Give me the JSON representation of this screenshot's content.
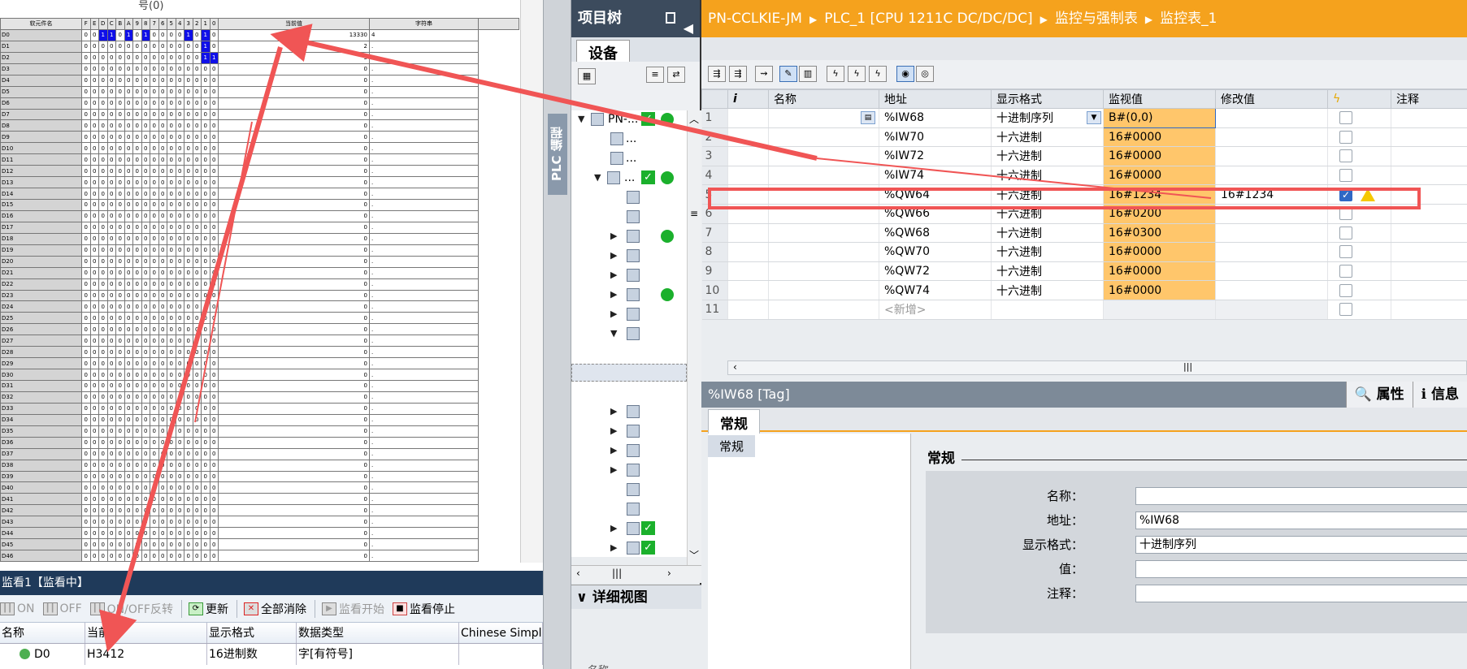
{
  "gx": {
    "title_fragment": "号(0)",
    "headers": {
      "device": "软元件名",
      "bits": [
        "F",
        "E",
        "D",
        "C",
        "B",
        "A",
        "9",
        "8",
        "7",
        "6",
        "5",
        "4",
        "3",
        "2",
        "1",
        "0"
      ],
      "value": "当前值",
      "string": "字符串"
    },
    "rows": [
      {
        "dev": "D0",
        "bits": "0011010100001010",
        "val": "13330",
        "str": "4"
      },
      {
        "dev": "D1",
        "bits": "0000000000000010",
        "val": "2",
        "str": "."
      },
      {
        "dev": "D2",
        "bits": "0000000000000011",
        "val": "3",
        "str": "."
      },
      {
        "dev": "D3",
        "bits": "0000000000000000",
        "val": "0",
        "str": "."
      },
      {
        "dev": "D4",
        "bits": "0000000000000000",
        "val": "0",
        "str": "."
      },
      {
        "dev": "D5",
        "bits": "0000000000000000",
        "val": "0",
        "str": "."
      },
      {
        "dev": "D6",
        "bits": "0000000000000000",
        "val": "0",
        "str": "."
      },
      {
        "dev": "D7",
        "bits": "0000000000000000",
        "val": "0",
        "str": "."
      },
      {
        "dev": "D8",
        "bits": "0000000000000000",
        "val": "0",
        "str": "."
      },
      {
        "dev": "D9",
        "bits": "0000000000000000",
        "val": "0",
        "str": "."
      },
      {
        "dev": "D10",
        "bits": "0000000000000000",
        "val": "0",
        "str": "."
      },
      {
        "dev": "D11",
        "bits": "0000000000000000",
        "val": "0",
        "str": "."
      },
      {
        "dev": "D12",
        "bits": "0000000000000000",
        "val": "0",
        "str": "."
      },
      {
        "dev": "D13",
        "bits": "0000000000000000",
        "val": "0",
        "str": "."
      },
      {
        "dev": "D14",
        "bits": "0000000000000000",
        "val": "0",
        "str": "."
      },
      {
        "dev": "D15",
        "bits": "0000000000000000",
        "val": "0",
        "str": "."
      },
      {
        "dev": "D16",
        "bits": "0000000000000000",
        "val": "0",
        "str": "."
      },
      {
        "dev": "D17",
        "bits": "0000000000000000",
        "val": "0",
        "str": "."
      },
      {
        "dev": "D18",
        "bits": "0000000000000000",
        "val": "0",
        "str": "."
      },
      {
        "dev": "D19",
        "bits": "0000000000000000",
        "val": "0",
        "str": "."
      },
      {
        "dev": "D20",
        "bits": "0000000000000000",
        "val": "0",
        "str": "."
      },
      {
        "dev": "D21",
        "bits": "0000000000000000",
        "val": "0",
        "str": "."
      },
      {
        "dev": "D22",
        "bits": "0000000000000000",
        "val": "0",
        "str": "."
      },
      {
        "dev": "D23",
        "bits": "0000000000000000",
        "val": "0",
        "str": "."
      },
      {
        "dev": "D24",
        "bits": "0000000000000000",
        "val": "0",
        "str": "."
      },
      {
        "dev": "D25",
        "bits": "0000000000000000",
        "val": "0",
        "str": "."
      },
      {
        "dev": "D26",
        "bits": "0000000000000000",
        "val": "0",
        "str": "."
      },
      {
        "dev": "D27",
        "bits": "0000000000000000",
        "val": "0",
        "str": "."
      },
      {
        "dev": "D28",
        "bits": "0000000000000000",
        "val": "0",
        "str": "."
      },
      {
        "dev": "D29",
        "bits": "0000000000000000",
        "val": "0",
        "str": "."
      },
      {
        "dev": "D30",
        "bits": "0000000000000000",
        "val": "0",
        "str": "."
      },
      {
        "dev": "D31",
        "bits": "0000000000000000",
        "val": "0",
        "str": "."
      },
      {
        "dev": "D32",
        "bits": "0000000000000000",
        "val": "0",
        "str": "."
      },
      {
        "dev": "D33",
        "bits": "0000000000000000",
        "val": "0",
        "str": "."
      },
      {
        "dev": "D34",
        "bits": "0000000000000000",
        "val": "0",
        "str": "."
      },
      {
        "dev": "D35",
        "bits": "0000000000000000",
        "val": "0",
        "str": "."
      },
      {
        "dev": "D36",
        "bits": "0000000000000000",
        "val": "0",
        "str": "."
      },
      {
        "dev": "D37",
        "bits": "0000000000000000",
        "val": "0",
        "str": "."
      },
      {
        "dev": "D38",
        "bits": "0000000000000000",
        "val": "0",
        "str": "."
      },
      {
        "dev": "D39",
        "bits": "0000000000000000",
        "val": "0",
        "str": "."
      },
      {
        "dev": "D40",
        "bits": "0000000000000000",
        "val": "0",
        "str": "."
      },
      {
        "dev": "D41",
        "bits": "0000000000000000",
        "val": "0",
        "str": "."
      },
      {
        "dev": "D42",
        "bits": "0000000000000000",
        "val": "0",
        "str": "."
      },
      {
        "dev": "D43",
        "bits": "0000000000000000",
        "val": "0",
        "str": "."
      },
      {
        "dev": "D44",
        "bits": "0000000000000000",
        "val": "0",
        "str": "."
      },
      {
        "dev": "D45",
        "bits": "0000000000000000",
        "val": "0",
        "str": "."
      },
      {
        "dev": "D46",
        "bits": "0000000000000000",
        "val": "0",
        "str": "."
      }
    ],
    "on_color": "#1010e8"
  },
  "monitor": {
    "title": "监看1【监看中】",
    "toolbar": {
      "on": "ON",
      "off": "OFF",
      "toggle": "ON/OFF反转",
      "refresh": "更新",
      "clear_all": "全部消除",
      "monitor_start": "监看开始",
      "monitor_stop": "监看停止"
    },
    "columns": [
      "名称",
      "当前值",
      "显示格式",
      "数据类型",
      "Chinese Simplified"
    ],
    "row": {
      "name": "D0",
      "value": "H3412",
      "format": "16进制数",
      "type": "字[有符号]",
      "comment": ""
    }
  },
  "sidebar": {
    "label": "PLC 编程"
  },
  "project_tree": {
    "title": "项目树",
    "tab": "设备",
    "root": "PN-...",
    "ellipsis": "...",
    "detail_view": "详细视图",
    "detail_col": "名称"
  },
  "breadcrumb": [
    "PN-CCLKIE-JM",
    "PLC_1 [CPU 1211C DC/DC/DC]",
    "监控与强制表",
    "监控表_1"
  ],
  "watch_table": {
    "headers": [
      "i",
      "名称",
      "地址",
      "显示格式",
      "监视值",
      "修改值",
      "",
      "注释"
    ],
    "rows": [
      {
        "n": "1",
        "addr": "%IW68",
        "fmt": "十进制序列",
        "mon": "B#(0,0)",
        "mod": "",
        "chk": false,
        "warn": false
      },
      {
        "n": "2",
        "addr": "%IW70",
        "fmt": "十六进制",
        "mon": "16#0000",
        "mod": "",
        "chk": false,
        "warn": false
      },
      {
        "n": "3",
        "addr": "%IW72",
        "fmt": "十六进制",
        "mon": "16#0000",
        "mod": "",
        "chk": false,
        "warn": false
      },
      {
        "n": "4",
        "addr": "%IW74",
        "fmt": "十六进制",
        "mon": "16#0000",
        "mod": "",
        "chk": false,
        "warn": false
      },
      {
        "n": "5",
        "addr": "%QW64",
        "fmt": "十六进制",
        "mon": "16#1234",
        "mod": "16#1234",
        "chk": true,
        "warn": true
      },
      {
        "n": "6",
        "addr": "%QW66",
        "fmt": "十六进制",
        "mon": "16#0200",
        "mod": "",
        "chk": false,
        "warn": false
      },
      {
        "n": "7",
        "addr": "%QW68",
        "fmt": "十六进制",
        "mon": "16#0300",
        "mod": "",
        "chk": false,
        "warn": false
      },
      {
        "n": "8",
        "addr": "%QW70",
        "fmt": "十六进制",
        "mon": "16#0000",
        "mod": "",
        "chk": false,
        "warn": false
      },
      {
        "n": "9",
        "addr": "%QW72",
        "fmt": "十六进制",
        "mon": "16#0000",
        "mod": "",
        "chk": false,
        "warn": false
      },
      {
        "n": "10",
        "addr": "%QW74",
        "fmt": "十六进制",
        "mon": "16#0000",
        "mod": "",
        "chk": false,
        "warn": false
      },
      {
        "n": "11",
        "addr": "<新增>",
        "fmt": "",
        "mon": "",
        "mod": "",
        "chk": false,
        "warn": false
      }
    ],
    "monitor_color": "#ffc66b"
  },
  "properties": {
    "header": "%IW68 [Tag]",
    "tab_props": "属性",
    "tab_info": "信息",
    "tab_general": "常规",
    "nav_general": "常规",
    "section_title": "常规",
    "fields": [
      {
        "label": "名称：",
        "value": ""
      },
      {
        "label": "地址：",
        "value": "%IW68"
      },
      {
        "label": "显示格式：",
        "value": "十进制序列"
      },
      {
        "label": "值：",
        "value": ""
      },
      {
        "label": "注释：",
        "value": ""
      }
    ]
  },
  "annotation_color": "#f05555",
  "breadcrumb_color": "#f5a21d"
}
